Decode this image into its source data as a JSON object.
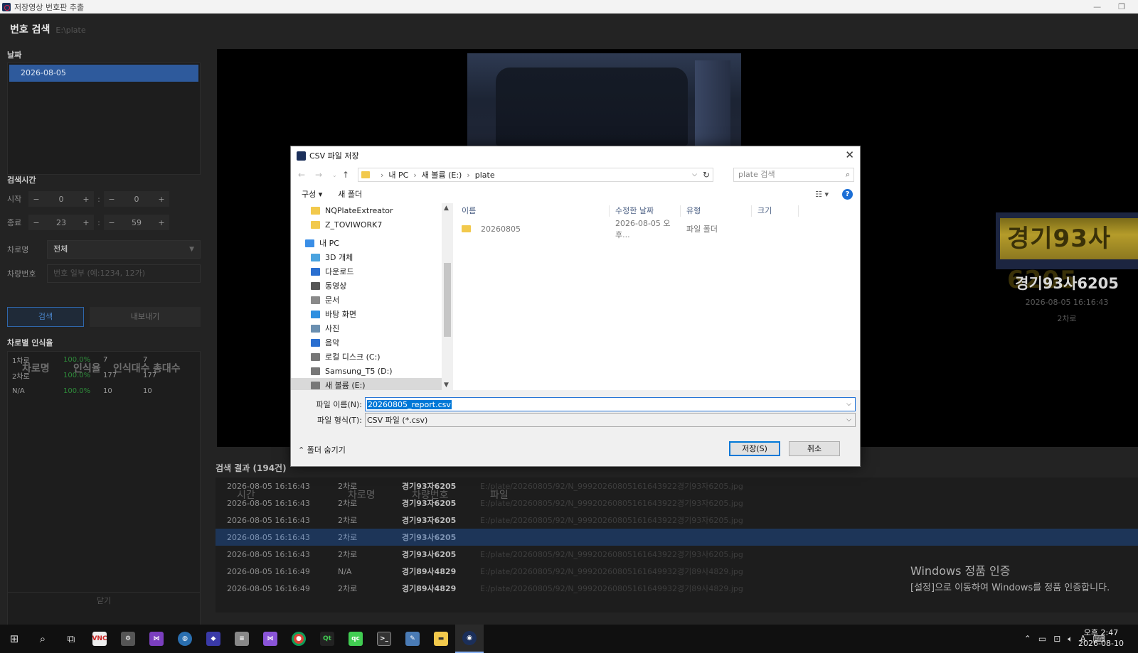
{
  "window": {
    "title": "저장영상 번호판 추출"
  },
  "app": {
    "heading": "번호 검색",
    "heading_path": "E:\\plate"
  },
  "sidebar": {
    "date_label": "날짜",
    "dates": [
      "2026-08-05"
    ],
    "time_label": "검색시간",
    "start_label": "시작",
    "end_label": "종료",
    "start_hour": "0",
    "start_min": "0",
    "end_hour": "23",
    "end_min": "59",
    "minus": "−",
    "plus": "+",
    "colon": ":",
    "lane_label": "차로명",
    "lane_value": "전체",
    "plate_label": "차량번호",
    "plate_placeholder": "번호 일부 (예:1234, 12가)",
    "search_button": "검색",
    "export_button": "내보내기",
    "rate_label": "차로별 인식율",
    "rate_headers": [
      "차로명",
      "인식율",
      "인식대수",
      "총대수"
    ],
    "rate_rows": [
      [
        "1차로",
        "100.0%",
        "7",
        "7"
      ],
      [
        "2차로",
        "100.0%",
        "177",
        "177"
      ],
      [
        "N/A",
        "100.0%",
        "10",
        "10"
      ]
    ],
    "close_button": "닫기"
  },
  "detail": {
    "plate_image_text": "경기93사6205",
    "plate_text": "경기93사6205",
    "time": "2026-08-05 16:16:43",
    "lane": "2차로"
  },
  "results": {
    "title": "검색 결과 (194건)",
    "headers": [
      "시간",
      "차로명",
      "차량번호",
      "파일"
    ],
    "rows": [
      [
        "2026-08-05 16:16:43",
        "2차로",
        "경기93자6205",
        "E:/plate/20260805/92/N_99920260805161643922경기93자6205.jpg"
      ],
      [
        "2026-08-05 16:16:43",
        "2차로",
        "경기93자6205",
        "E:/plate/20260805/92/N_99920260805161643922경기93자6205.jpg"
      ],
      [
        "2026-08-05 16:16:43",
        "2차로",
        "경기93자6205",
        "E:/plate/20260805/92/N_99920260805161643922경기93자6205.jpg"
      ],
      [
        "2026-08-05 16:16:43",
        "2차로",
        "경기93사6205",
        ""
      ],
      [
        "2026-08-05 16:16:43",
        "2차로",
        "경기93사6205",
        "E:/plate/20260805/92/N_99920260805161643922경기93사6205.jpg"
      ],
      [
        "2026-08-05 16:16:49",
        "N/A",
        "경기89사4829",
        "E:/plate/20260805/92/N_99920260805161649932경기89사4829.jpg"
      ],
      [
        "2026-08-05 16:16:49",
        "2차로",
        "경기89사4829",
        "E:/plate/20260805/92/N_99920260805161649932경기89사4829.jpg"
      ]
    ],
    "selected_index": 3
  },
  "dialog": {
    "title": "CSV 파일 저장",
    "crumbs": [
      "내 PC",
      "새 볼륨 (E:)",
      "plate"
    ],
    "search_placeholder": "plate 검색",
    "organize": "구성 ▾",
    "new_folder": "새 폴더",
    "help": "?",
    "tree": [
      {
        "label": "NQPlateExtreator",
        "icon": "folder-icon",
        "indent": 1
      },
      {
        "label": "Z_TOVIWORK7",
        "icon": "folder-icon",
        "indent": 1
      },
      {
        "label": "내 PC",
        "icon": "pc-icon",
        "indent": 0
      },
      {
        "label": "3D 개체",
        "icon": "3d-objects-icon",
        "indent": 1
      },
      {
        "label": "다운로드",
        "icon": "download-icon",
        "indent": 1
      },
      {
        "label": "동영상",
        "icon": "video-icon",
        "indent": 1
      },
      {
        "label": "문서",
        "icon": "document-icon",
        "indent": 1
      },
      {
        "label": "바탕 화면",
        "icon": "desktop-icon",
        "indent": 1
      },
      {
        "label": "사진",
        "icon": "picture-icon",
        "indent": 1
      },
      {
        "label": "음악",
        "icon": "music-icon",
        "indent": 1
      },
      {
        "label": "로컬 디스크 (C:)",
        "icon": "drive-icon",
        "indent": 1
      },
      {
        "label": "Samsung_T5 (D:)",
        "icon": "drive-icon",
        "indent": 1
      },
      {
        "label": "새 볼륨 (E:)",
        "icon": "drive-icon",
        "indent": 1
      }
    ],
    "tree_selected": 12,
    "columns": [
      "이름",
      "수정한 날짜",
      "유형",
      "크기"
    ],
    "files": [
      {
        "name": "20260805",
        "modified": "2026-08-05 오후...",
        "type": "파일 폴더",
        "size": ""
      }
    ],
    "filename_label": "파일 이름(N):",
    "filename_value": "20260805_report.csv",
    "filetype_label": "파일 형식(T):",
    "filetype_value": "CSV 파일 (*.csv)",
    "hide_folders": "폴더 숨기기",
    "save_button": "저장(S)",
    "cancel_button": "취소"
  },
  "watermark": {
    "line1": "Windows 정품 인증",
    "line2": "[설정]으로 이동하여 Windows를 정품 인증합니다."
  },
  "taskbar": {
    "apps": [
      "start",
      "search",
      "task-view",
      "vnc",
      "tool",
      "visual-studio",
      "globe",
      "app",
      "database",
      "vs-code",
      "chrome",
      "qt",
      "qc",
      "terminal",
      "paint",
      "explorer",
      "plate-app"
    ],
    "active": "plate-app",
    "ime": "A",
    "clock_time": "오후 2:47",
    "clock_date": "2026-08-10"
  },
  "colors": {
    "accent": "#2e5a9c",
    "selection": "#0078d7",
    "rate_green": "#2e8b3a"
  }
}
